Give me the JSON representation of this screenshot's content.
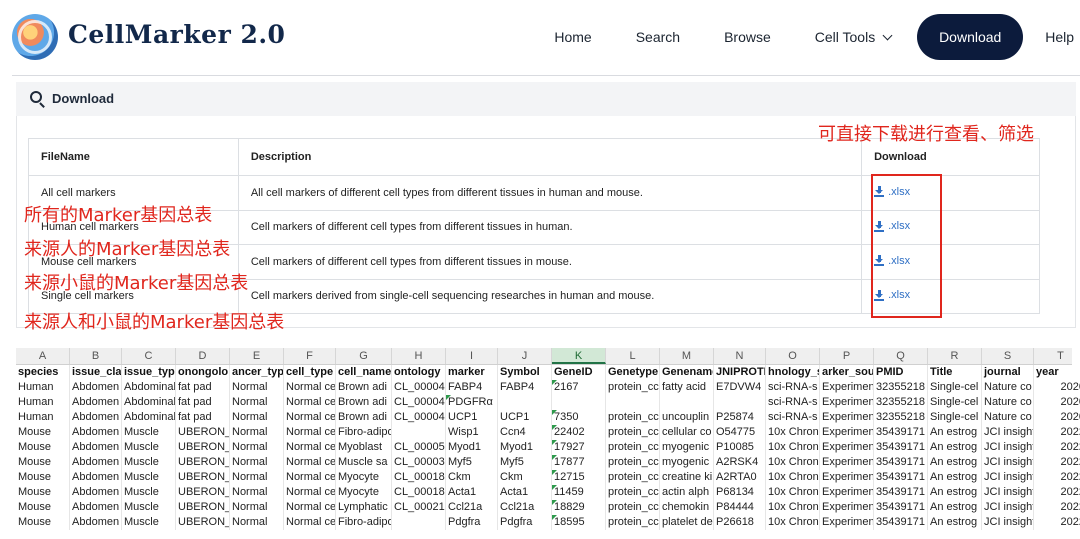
{
  "header": {
    "brand": "CellMarker 2.0",
    "nav": [
      "Home",
      "Search",
      "Browse",
      "Cell Tools",
      "Download",
      "Help"
    ]
  },
  "panel": {
    "title": "Download",
    "table_headers": [
      "FileName",
      "Description",
      "Download"
    ],
    "rows": [
      {
        "file": "All cell markers",
        "desc": "All cell markers of different cell types from different tissues in human and mouse.",
        "link": ".xlsx"
      },
      {
        "file": "Human cell markers",
        "desc": "Cell markers of different cell types from different tissues in human.",
        "link": ".xlsx"
      },
      {
        "file": "Mouse cell markers",
        "desc": "Cell markers of different cell types from different tissues in mouse.",
        "link": ".xlsx"
      },
      {
        "file": "Single cell markers",
        "desc": "Cell markers derived from single-cell sequencing researches in human and mouse.",
        "link": ".xlsx"
      }
    ]
  },
  "annotations": {
    "top": "可直接下载进行查看、筛选",
    "all": "所有的Marker基因总表",
    "human": "来源人的Marker基因总表",
    "mouse": "来源小鼠的Marker基因总表",
    "single": "来源人和小鼠的Marker基因总表"
  },
  "sheet": {
    "col_letters": [
      "A",
      "B",
      "C",
      "D",
      "E",
      "F",
      "G",
      "H",
      "I",
      "J",
      "K",
      "L",
      "M",
      "N",
      "O",
      "P",
      "Q",
      "R",
      "S",
      "T"
    ],
    "selected_col": "K",
    "headers": [
      "species",
      "issue_clas",
      "issue_type",
      "onongolo",
      "ancer_typ",
      "cell_type",
      "cell_name",
      "ontology",
      "marker",
      "Symbol",
      "GeneID",
      "Genetype",
      "Genename",
      "JNIPROTII",
      "hnology_s",
      "arker_sour",
      "PMID",
      "Title",
      "journal",
      "year"
    ],
    "rows": [
      [
        "Human",
        "Abdomen",
        "Abdominal",
        "fat pad",
        "Normal",
        "Normal ce",
        "Brown adi",
        "CL_00004",
        "FABP4",
        "FABP4",
        "2167",
        "protein_cc",
        "fatty acid",
        "E7DVW4",
        "sci-RNA-s",
        "Experimen",
        "32355218",
        "Single-cel",
        "Nature co",
        "2020"
      ],
      [
        "Human",
        "Abdomen",
        "Abdominal",
        "fat pad",
        "Normal",
        "Normal ce",
        "Brown adi",
        "CL_00004",
        "PDGFRα",
        "",
        "",
        "",
        "",
        "",
        "sci-RNA-s",
        "Experimen",
        "32355218",
        "Single-cel",
        "Nature co",
        "2020"
      ],
      [
        "Human",
        "Abdomen",
        "Abdominal",
        "fat pad",
        "Normal",
        "Normal ce",
        "Brown adi",
        "CL_00004",
        "UCP1",
        "UCP1",
        "7350",
        "protein_cc",
        "uncouplin",
        "P25874",
        "sci-RNA-s",
        "Experimen",
        "32355218",
        "Single-cel",
        "Nature co",
        "2020"
      ],
      [
        "Mouse",
        "Abdomen",
        "Muscle",
        "UBERON_",
        "Normal",
        "Normal ce",
        "Fibro-adipogenic prc",
        "",
        "Wisp1",
        "Ccn4",
        "22402",
        "protein_cc",
        "cellular co",
        "O54775",
        "10x Chron",
        "Experimen",
        "35439171",
        "An estrog",
        "JCI insight",
        "2022"
      ],
      [
        "Mouse",
        "Abdomen",
        "Muscle",
        "UBERON_",
        "Normal",
        "Normal ce",
        "Myoblast",
        "CL_00005",
        "Myod1",
        "Myod1",
        "17927",
        "protein_cc",
        "myogenic",
        "P10085",
        "10x Chron",
        "Experimen",
        "35439171",
        "An estrog",
        "JCI insight",
        "2022"
      ],
      [
        "Mouse",
        "Abdomen",
        "Muscle",
        "UBERON_",
        "Normal",
        "Normal ce",
        "Muscle sa",
        "CL_00003",
        "Myf5",
        "Myf5",
        "17877",
        "protein_cc",
        "myogenic",
        "A2RSK4",
        "10x Chron",
        "Experimen",
        "35439171",
        "An estrog",
        "JCI insight",
        "2022"
      ],
      [
        "Mouse",
        "Abdomen",
        "Muscle",
        "UBERON_",
        "Normal",
        "Normal ce",
        "Myocyte",
        "CL_00018",
        "Ckm",
        "Ckm",
        "12715",
        "protein_cc",
        "creatine ki",
        "A2RTA0",
        "10x Chron",
        "Experimen",
        "35439171",
        "An estrog",
        "JCI insight",
        "2022"
      ],
      [
        "Mouse",
        "Abdomen",
        "Muscle",
        "UBERON_",
        "Normal",
        "Normal ce",
        "Myocyte",
        "CL_00018",
        "Acta1",
        "Acta1",
        "11459",
        "protein_cc",
        "actin alph",
        "P68134",
        "10x Chron",
        "Experimen",
        "35439171",
        "An estrog",
        "JCI insight",
        "2022"
      ],
      [
        "Mouse",
        "Abdomen",
        "Muscle",
        "UBERON_",
        "Normal",
        "Normal ce",
        "Lymphatic",
        "CL_00021",
        "Ccl21a",
        "Ccl21a",
        "18829",
        "protein_cc",
        "chemokin",
        "P84444",
        "10x Chron",
        "Experimen",
        "35439171",
        "An estrog",
        "JCI insight",
        "2022"
      ],
      [
        "Mouse",
        "Abdomen",
        "Muscle",
        "UBERON_",
        "Normal",
        "Normal ce",
        "Fibro-adipogenic prc",
        "",
        "Pdgfra",
        "Pdgfra",
        "18595",
        "protein_cc",
        "platelet de",
        "P26618",
        "10x Chron",
        "Experimen",
        "35439171",
        "An estrog",
        "JCI insight",
        "2022"
      ]
    ]
  }
}
